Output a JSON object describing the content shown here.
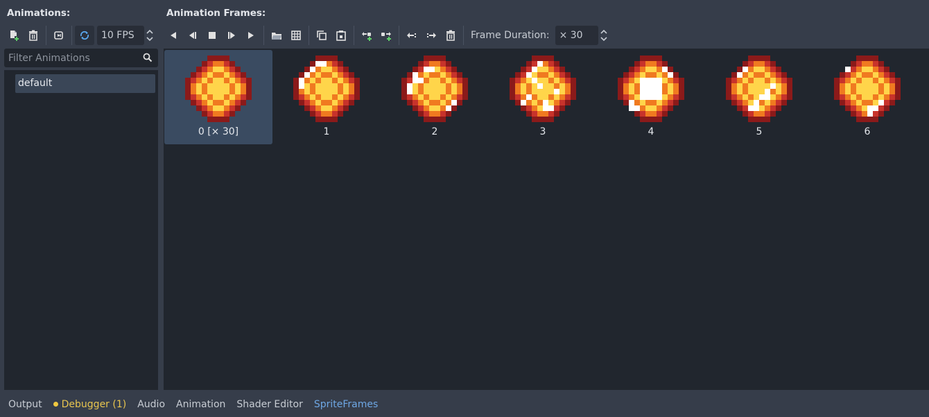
{
  "animations_panel": {
    "header": "Animations:",
    "fps": "10 FPS",
    "filter_placeholder": "Filter Animations",
    "items": [
      {
        "label": "default",
        "selected": true
      }
    ]
  },
  "frames_panel": {
    "header": "Animation Frames:",
    "frame_duration_label": "Frame Duration:",
    "frame_duration_value": "× 30",
    "frames": [
      {
        "label": "0 [× 30]",
        "variant": 0,
        "selected": true
      },
      {
        "label": "1",
        "variant": 1
      },
      {
        "label": "2",
        "variant": 2
      },
      {
        "label": "3",
        "variant": 3
      },
      {
        "label": "4",
        "variant": 4
      },
      {
        "label": "5",
        "variant": 5
      },
      {
        "label": "6",
        "variant": 6
      }
    ]
  },
  "toolbar_icons": {
    "left": [
      "new-animation-icon",
      "delete-animation-icon",
      "autoplay-icon",
      "loop-icon"
    ],
    "right": [
      "play-backwards-icon",
      "play-from-end-backwards-icon",
      "stop-icon",
      "play-from-start-icon",
      "play-icon",
      "load-frames-icon",
      "load-from-sheet-icon",
      "copy-frame-icon",
      "paste-frame-icon",
      "insert-frame-before-icon",
      "insert-frame-after-icon",
      "move-frame-left-icon",
      "move-frame-right-icon",
      "delete-frame-icon"
    ]
  },
  "bottom_tabs": [
    {
      "label": "Output"
    },
    {
      "label": "Debugger (1)",
      "warning": true
    },
    {
      "label": "Audio"
    },
    {
      "label": "Animation"
    },
    {
      "label": "Shader Editor"
    },
    {
      "label": "SpriteFrames",
      "active": true
    }
  ],
  "colors": {
    "background": "#363d4a",
    "panel": "#21262e",
    "selection": "#3a4b61",
    "accent": "#6ea7e4",
    "warning": "#f0c940",
    "sprite_dark": "#8b1a1a",
    "sprite_red": "#c8332b",
    "sprite_orange": "#f07a20",
    "sprite_yellow": "#ffd54a",
    "sprite_white": "#ffffff"
  }
}
